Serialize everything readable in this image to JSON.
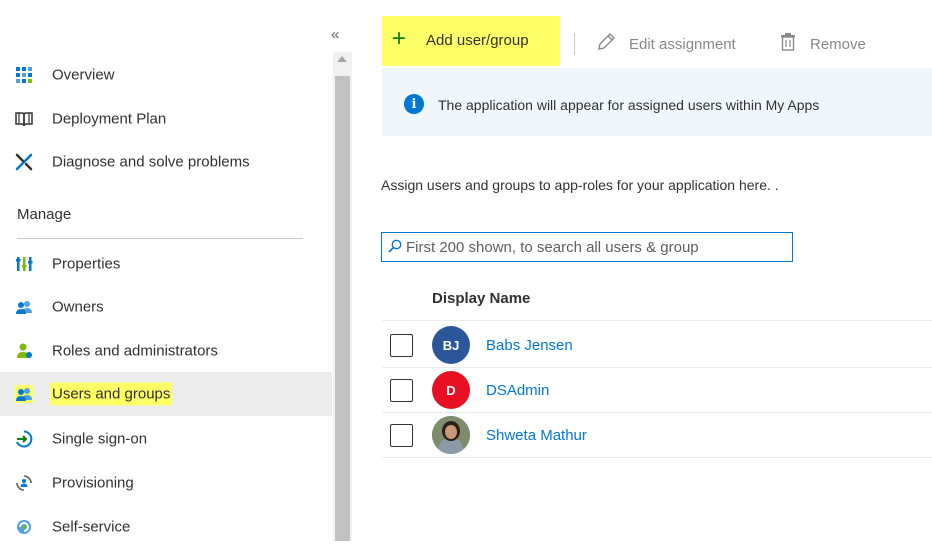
{
  "sidebar": {
    "collapse_glyph": "«",
    "section_manage": "Manage",
    "items": [
      {
        "label": "Overview",
        "icon": "overview-grid-icon"
      },
      {
        "label": "Deployment Plan",
        "icon": "book-icon"
      },
      {
        "label": "Diagnose and solve problems",
        "icon": "wrench-icon"
      },
      {
        "label": "Properties",
        "icon": "properties-bars-icon"
      },
      {
        "label": "Owners",
        "icon": "owners-icon"
      },
      {
        "label": "Roles and administrators",
        "icon": "roles-icon"
      },
      {
        "label": "Users and groups",
        "icon": "users-groups-icon",
        "active": true
      },
      {
        "label": "Single sign-on",
        "icon": "sso-icon"
      },
      {
        "label": "Provisioning",
        "icon": "provisioning-icon"
      },
      {
        "label": "Self-service",
        "icon": "self-service-icon"
      }
    ]
  },
  "toolbar": {
    "add_label": "Add user/group",
    "edit_label": "Edit assignment",
    "remove_label": "Remove"
  },
  "banner": {
    "text": "The application will appear for assigned users within My Apps"
  },
  "main": {
    "assign_text": "Assign users and groups to app-roles for your application here. ."
  },
  "search": {
    "placeholder": "First 200 shown, to search all users & group"
  },
  "table": {
    "header_display_name": "Display Name",
    "rows": [
      {
        "initials": "BJ",
        "name": "Babs Jensen",
        "avatar_color": "#2b579a"
      },
      {
        "initials": "D",
        "name": "DSAdmin",
        "avatar_color": "#e81123"
      },
      {
        "initials": "",
        "name": "Shweta Mathur",
        "avatar_color": "#6b7a5a"
      }
    ]
  },
  "colors": {
    "highlight": "#ffff66",
    "accent": "#0078d4",
    "plus_green": "#107c10"
  }
}
